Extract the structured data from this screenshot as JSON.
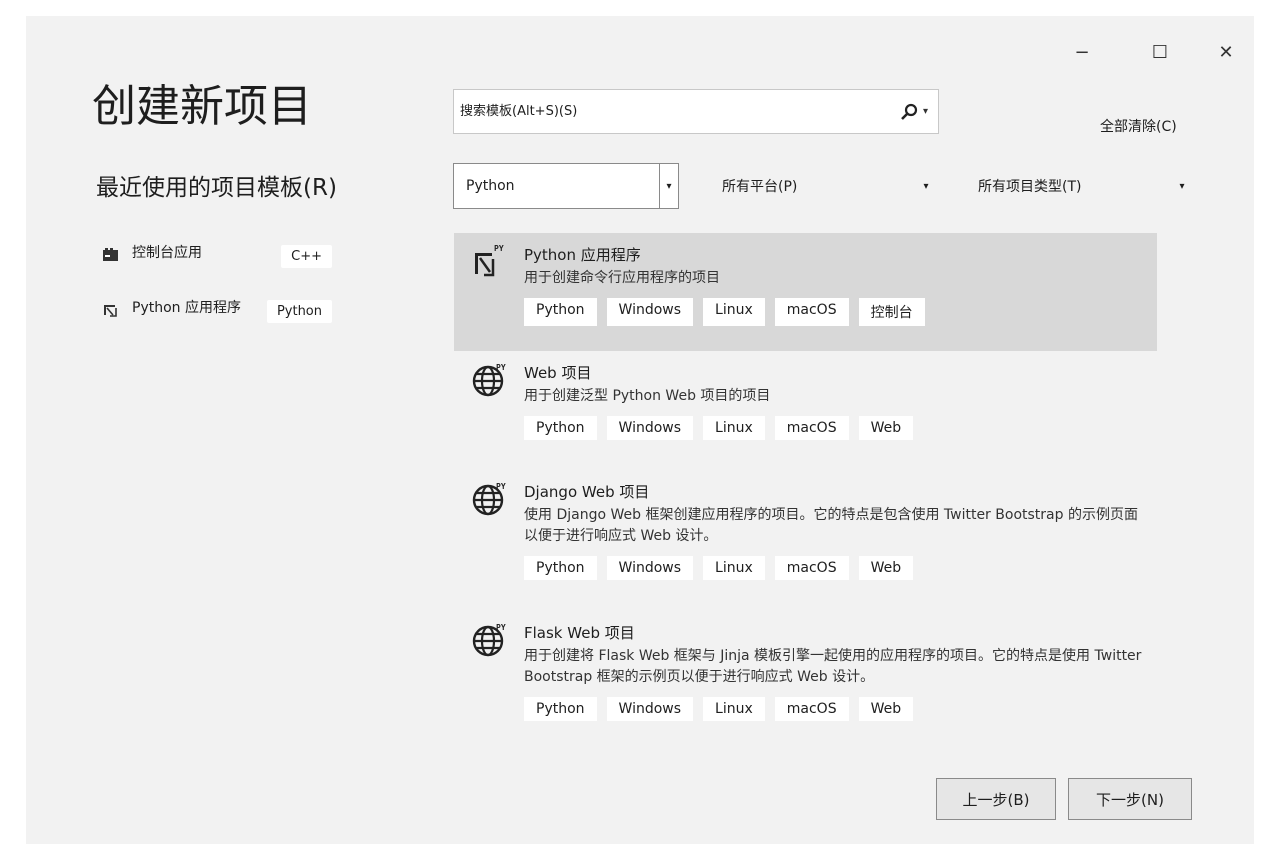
{
  "window": {
    "minimize_glyph": "−",
    "maximize_glyph": "☐",
    "close_glyph": "✕"
  },
  "title": "创建新项目",
  "recent": {
    "heading": "最近使用的项目模板(R)",
    "items": [
      {
        "label": "控制台应用",
        "tag": "C++",
        "icon": "console-app-icon"
      },
      {
        "label": "Python 应用程序",
        "tag": "Python",
        "icon": "python-app-icon"
      }
    ]
  },
  "search": {
    "placeholder": "搜索模板(Alt+S)(S)",
    "icon": "search-icon"
  },
  "clear_all": "全部清除(C)",
  "filters": {
    "language": "Python",
    "platform": "所有平台(P)",
    "project_type": "所有项目类型(T)"
  },
  "templates": [
    {
      "name": "Python 应用程序",
      "description": "用于创建命令行应用程序的项目",
      "tags": [
        "Python",
        "Windows",
        "Linux",
        "macOS",
        "控制台"
      ],
      "icon": "python-console-icon",
      "selected": true
    },
    {
      "name": "Web 项目",
      "description": "用于创建泛型 Python Web 项目的项目",
      "tags": [
        "Python",
        "Windows",
        "Linux",
        "macOS",
        "Web"
      ],
      "icon": "python-web-icon",
      "selected": false
    },
    {
      "name": "Django Web 项目",
      "description": "使用 Django Web 框架创建应用程序的项目。它的特点是包含使用 Twitter Bootstrap 的示例页面以便于进行响应式 Web 设计。",
      "tags": [
        "Python",
        "Windows",
        "Linux",
        "macOS",
        "Web"
      ],
      "icon": "python-web-icon",
      "selected": false
    },
    {
      "name": "Flask Web 项目",
      "description": "用于创建将 Flask Web 框架与 Jinja 模板引擎一起使用的应用程序的项目。它的特点是使用 Twitter Bootstrap 框架的示例页以便于进行响应式 Web 设计。",
      "tags": [
        "Python",
        "Windows",
        "Linux",
        "macOS",
        "Web"
      ],
      "icon": "python-web-icon",
      "selected": false
    }
  ],
  "buttons": {
    "back": "上一步(B)",
    "next": "下一步(N)"
  }
}
